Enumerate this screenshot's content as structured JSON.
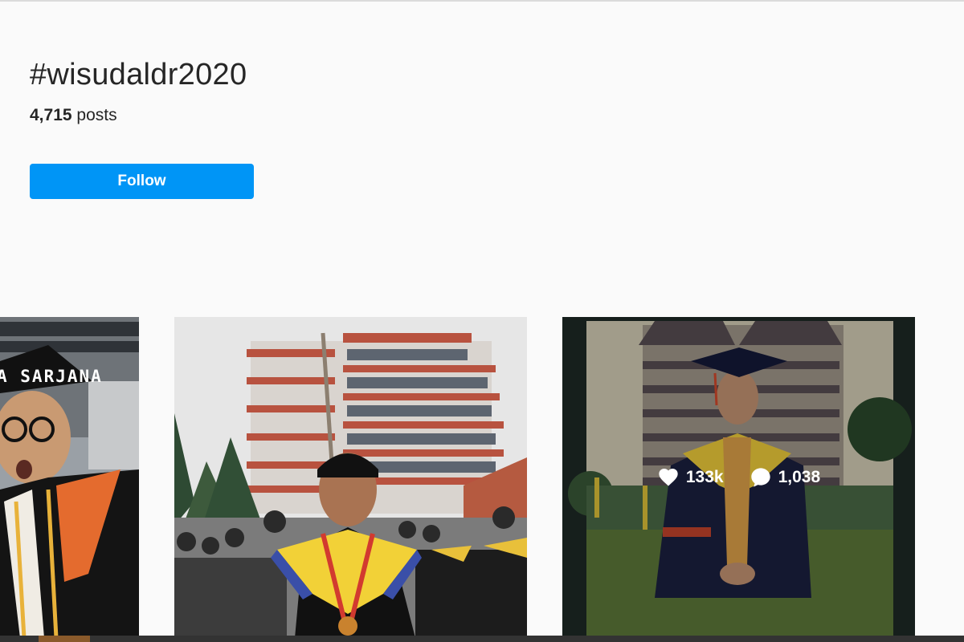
{
  "hashtag": {
    "title": "#wisudaldr2020",
    "post_count": "4,715",
    "post_count_label": " posts",
    "follow_label": "Follow"
  },
  "posts": [
    {
      "caption_text": "A SARJANA"
    },
    {
      "caption_text": ""
    },
    {
      "likes": "133k",
      "comments": "1,038"
    }
  ],
  "colors": {
    "accent": "#0095f6",
    "background": "#fafafa"
  }
}
